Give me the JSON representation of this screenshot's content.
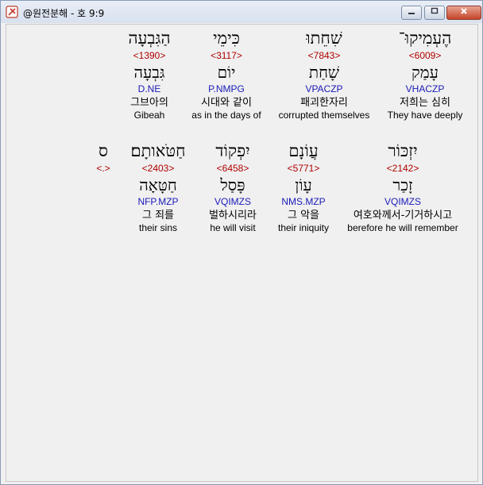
{
  "window": {
    "title": "@원전분해 - 호 9:9"
  },
  "words": [
    {
      "heb": "הַגִּבְעָה",
      "strong": "<1390>",
      "lemma": "גִּבְעָה",
      "parse": "D.NE",
      "ko": "그브아의",
      "en": "Gibeah"
    },
    {
      "heb": "כִּימֵי",
      "strong": "<3117>",
      "lemma": "יוֹם",
      "parse": "P.NMPG",
      "ko": "시대와 같이",
      "en": "as in the days of"
    },
    {
      "heb": "שִׁחֵתוּ",
      "strong": "<7843>",
      "lemma": "שָׁחַת",
      "parse": "VPACZP",
      "ko": "패괴한자리",
      "en": "corrupted themselves"
    },
    {
      "heb": "הֶעְמִיקוּ־",
      "strong": "<6009>",
      "lemma": "עָמַק",
      "parse": "VHACZP",
      "ko": "저희는 심히",
      "en": "They have deeply"
    },
    {
      "heb": "ס",
      "strong": "<.>",
      "lemma": "",
      "parse": "",
      "ko": "",
      "en": ""
    },
    {
      "heb": "חַטֹּאותָם׃",
      "strong": "<2403>",
      "lemma": "חַטָּאָה",
      "parse": "NFP.MZP",
      "ko": "그 죄를",
      "en": "their sins"
    },
    {
      "heb": "יִפְקוֹד",
      "strong": "<6458>",
      "lemma": "פָּסַל",
      "parse": "VQIMZS",
      "ko": "벌하시리라",
      "en": "he will visit"
    },
    {
      "heb": "עֲוֹנָם",
      "strong": "<5771>",
      "lemma": "עָוֹן",
      "parse": "NMS.MZP",
      "ko": "그 악을",
      "en": "their iniquity"
    },
    {
      "heb": "יִזְכּוֹר",
      "strong": "<2142>",
      "lemma": "זָכַר",
      "parse": "VQIMZS",
      "ko": "여호와께서-기거하시고",
      "en": "berefore he will remember"
    }
  ]
}
